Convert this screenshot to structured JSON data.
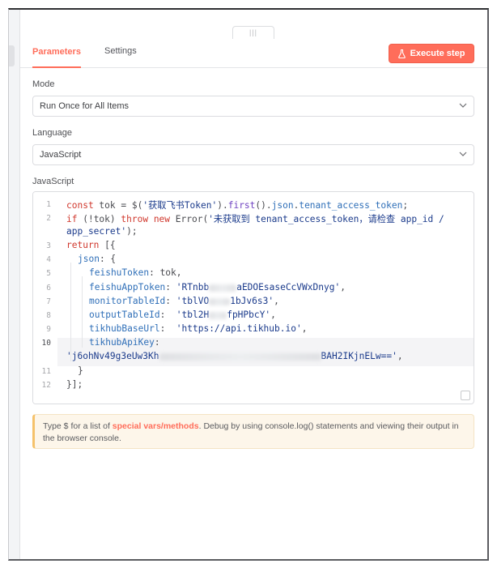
{
  "tabs": {
    "parameters": "Parameters",
    "settings": "Settings"
  },
  "toolbar": {
    "execute_label": "Execute step"
  },
  "mode": {
    "label": "Mode",
    "value": "Run Once for All Items"
  },
  "language": {
    "label": "Language",
    "value": "JavaScript"
  },
  "editor": {
    "label": "JavaScript",
    "line_numbers": [
      "1",
      "2",
      "3",
      "4",
      "5",
      "6",
      "7",
      "8",
      "9",
      "10",
      "11",
      "12"
    ],
    "l1": {
      "k": "const",
      "v": " tok = ",
      "f": "$(",
      "s": "'获取飞书Token'",
      "p": ").",
      "m1": "first",
      "p2": "().",
      "m2": "json",
      "p3": ".",
      "m3": "tenant_access_token",
      "p4": ";"
    },
    "l2": {
      "a": "if",
      "b": " (!tok) ",
      "c": "throw",
      "d": " ",
      "e": "new",
      "f": " Error(",
      "s": "'未获取到 tenant_access_token，请检查 app_id /"
    },
    "l2b": {
      "s": "app_secret'",
      "p": ");"
    },
    "l3": {
      "k": "return",
      "p": " [{"
    },
    "l4": {
      "k": "json",
      "p": ": {"
    },
    "l5": {
      "k": "feishuToken",
      "p": ": tok,"
    },
    "l6": {
      "k": "feishuAppToken",
      "p": ": ",
      "s1": "'RTnbb",
      "s2": "aEDOEsaseCcVWxDnyg'",
      "p2": ","
    },
    "l7": {
      "k": "monitorTableId",
      "p": ": ",
      "s1": "'tblVO",
      "s2": "1bJv6s3'",
      "p2": ","
    },
    "l8": {
      "k": "outputTableId",
      "p": ":  ",
      "s1": "'tbl2H",
      "s2": "fpHPbcY'",
      "p2": ","
    },
    "l9": {
      "k": "tikhubBaseUrl",
      "p": ":  ",
      "s": "'https://api.tikhub.io'",
      "p2": ","
    },
    "l10": {
      "k": "tikhubApiKey",
      "p": ":"
    },
    "l10b": {
      "s1": "'j6ohNv49g3eUw3Kh",
      "s2": "BAH2IKjnELw=='",
      "p": ","
    },
    "l11": {
      "p": "}"
    },
    "l12": {
      "p": "}];"
    }
  },
  "notice": {
    "before": "Type $ for a list of ",
    "highlight": "special vars/methods",
    "after": ". Debug by using console.log() statements and viewing their output in the browser console."
  },
  "colors": {
    "accent": "#ff6d5a",
    "notice_bg": "#fdf6ea",
    "notice_border": "#f5c26b"
  }
}
